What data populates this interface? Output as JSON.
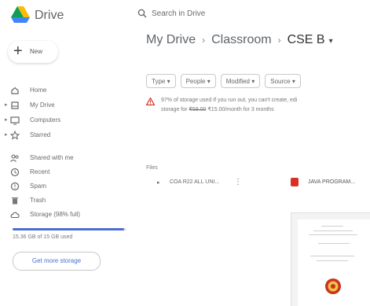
{
  "header": {
    "brand": "Drive",
    "search_placeholder": "Search in Drive"
  },
  "sidebar": {
    "new_label": "New",
    "items": [
      {
        "label": "Home",
        "icon": "home-icon",
        "arrow": false
      },
      {
        "label": "My Drive",
        "icon": "my-drive-icon",
        "arrow": true
      },
      {
        "label": "Computers",
        "icon": "computers-icon",
        "arrow": true
      },
      {
        "label": "Starred",
        "icon": "star-icon",
        "arrow": true
      },
      {
        "label": "Shared with me",
        "icon": "shared-icon",
        "arrow": false
      },
      {
        "label": "Recent",
        "icon": "clock-icon",
        "arrow": false
      },
      {
        "label": "Spam",
        "icon": "spam-icon",
        "arrow": false
      },
      {
        "label": "Trash",
        "icon": "trash-icon",
        "arrow": false
      },
      {
        "label": "Storage (98% full)",
        "icon": "cloud-icon",
        "arrow": false
      }
    ],
    "storage_text": "15.36 GB of 15 GB used",
    "storage_fraction": 0.98,
    "get_storage_label": "Get more storage"
  },
  "breadcrumb": {
    "items": [
      "My Drive",
      "Classroom",
      "CSE B"
    ],
    "separator": "›",
    "dropdown": "▾"
  },
  "filters": [
    "Type",
    "People",
    "Modified",
    "Source"
  ],
  "warning": {
    "line1": "97% of storage used If you run out, you can't create, edi",
    "line2_prefix": "storage for ",
    "line2_old_price": "₹59.00",
    "line2_suffix": " ₹15.00/month for 3 months"
  },
  "files": {
    "section_label": "Files",
    "folder_name": "COA R22 ALL UNI...",
    "file_name": "JAVA PROGRAM..."
  },
  "colors": {
    "accent": "#4a6fd1",
    "warning": "#d93025",
    "pdf": "#d93025"
  }
}
